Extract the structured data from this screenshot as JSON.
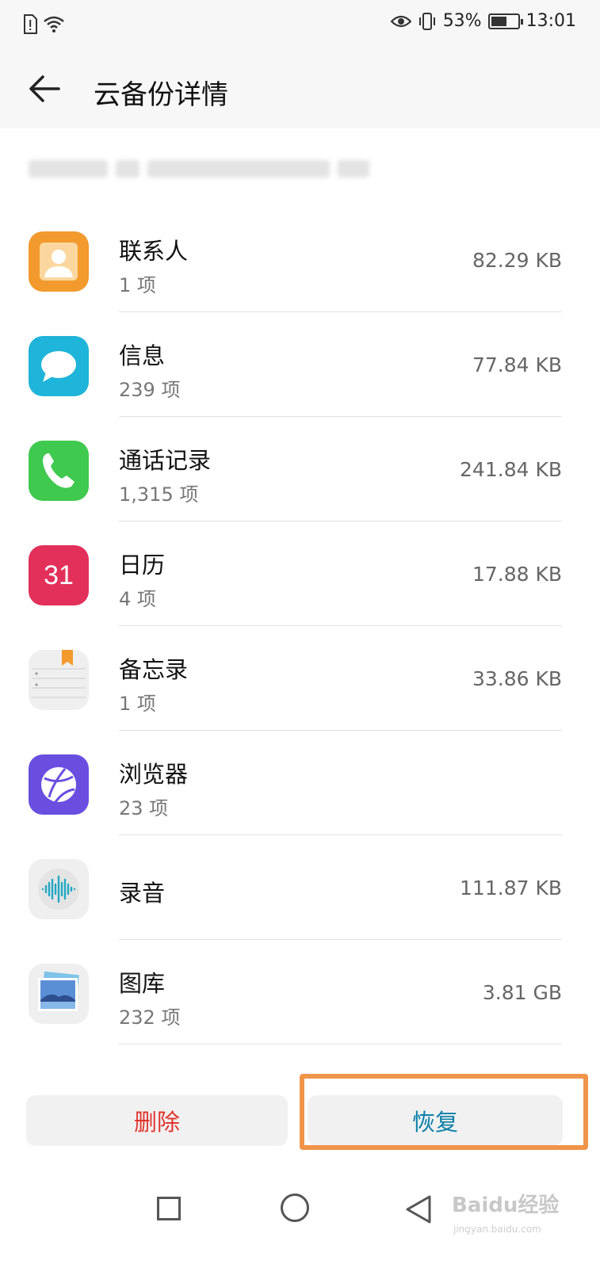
{
  "status_bar": {
    "battery_percent": "53%",
    "battery_level": 0.53,
    "time": "13:01",
    "icons": [
      "sim-alert-icon",
      "wifi-icon",
      "eye-comfort-icon",
      "vibrate-icon",
      "battery-icon"
    ]
  },
  "header": {
    "title": "云备份详情"
  },
  "items": [
    {
      "name": "联系人",
      "count": "1 项",
      "size": "82.29 KB",
      "icon": "contacts-icon",
      "color": "#f29a2e"
    },
    {
      "name": "信息",
      "count": "239 项",
      "size": "77.84 KB",
      "icon": "messages-icon",
      "color": "#1fb4d9"
    },
    {
      "name": "通话记录",
      "count": "1,315 项",
      "size": "241.84 KB",
      "icon": "phone-icon",
      "color": "#3fc94f"
    },
    {
      "name": "日历",
      "count": "4 项",
      "size": "17.88 KB",
      "icon": "calendar-icon",
      "color": "#e2305a",
      "icon_text": "31"
    },
    {
      "name": "备忘录",
      "count": "1 项",
      "size": "33.86 KB",
      "icon": "notepad-icon",
      "color": "#efefef"
    },
    {
      "name": "浏览器",
      "count": "23 项",
      "size": "",
      "icon": "browser-icon",
      "color": "#6a4ee0"
    },
    {
      "name": "录音",
      "count": "",
      "size": "111.87 KB",
      "icon": "recorder-icon",
      "color": "#efefef"
    },
    {
      "name": "图库",
      "count": "232 项",
      "size": "3.81 GB",
      "icon": "gallery-icon",
      "color": "#efefef"
    }
  ],
  "actions": {
    "delete_label": "删除",
    "restore_label": "恢复"
  },
  "watermark": {
    "brand": "Baidu经验",
    "site": "jingyan.baidu.com"
  }
}
